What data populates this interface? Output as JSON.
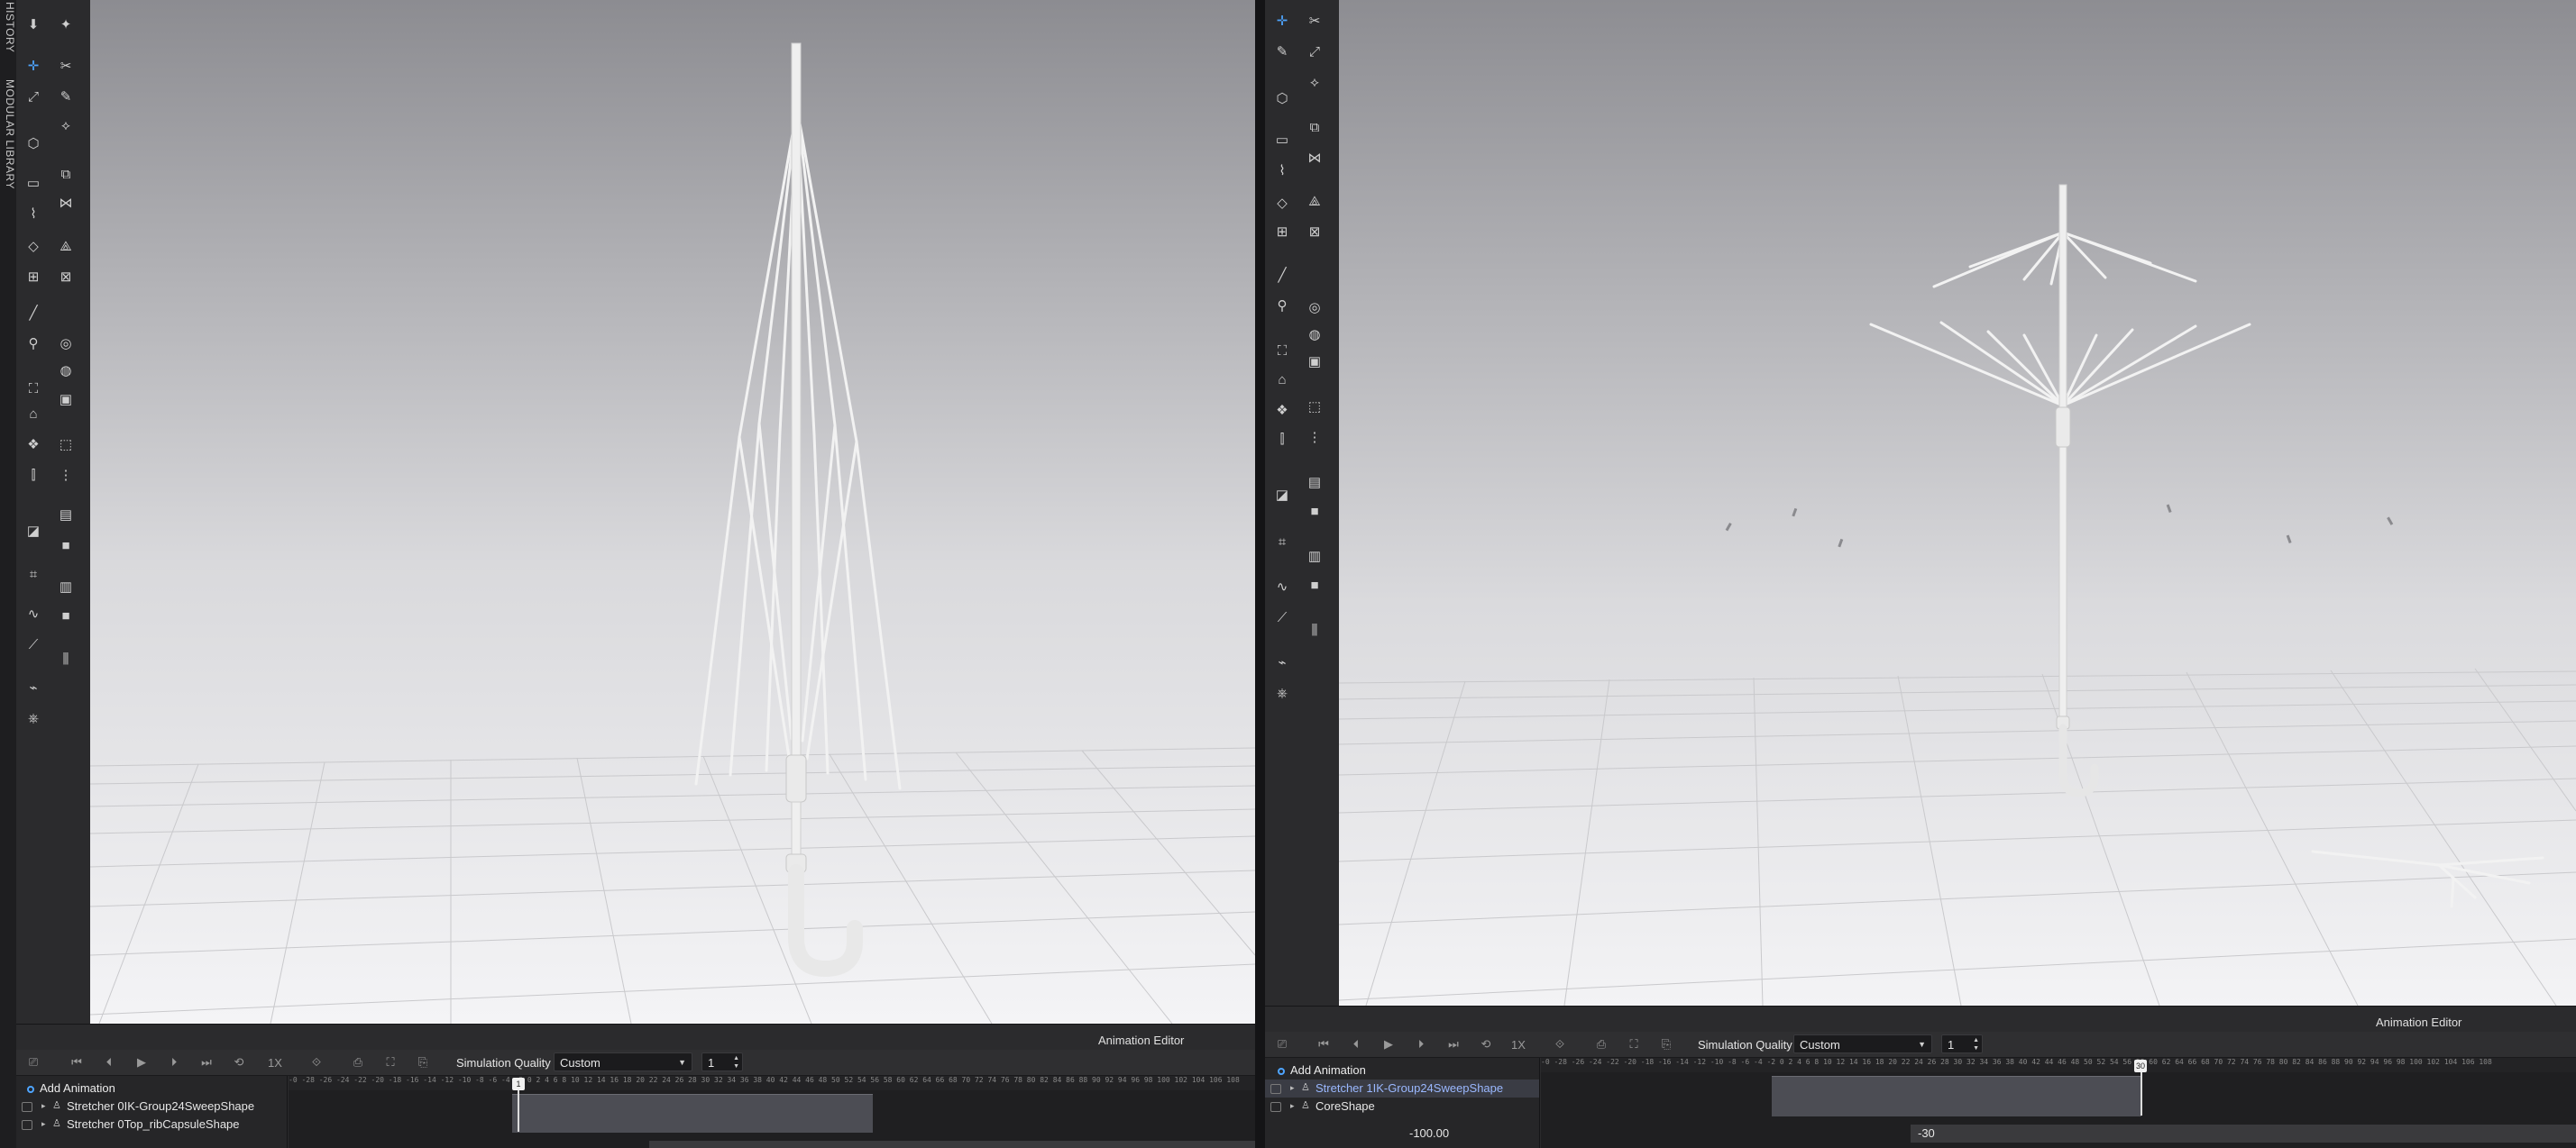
{
  "side_tabs": [
    "HISTORY",
    "MODULAR LIBRARY"
  ],
  "left": {
    "animation_editor": {
      "title": "Animation Editor",
      "speed_label": "1X",
      "simulation_quality_label": "Simulation Quality",
      "simulation_quality_value": "Custom",
      "step_value": "1",
      "add_animation_label": "Add Animation",
      "tracks": [
        {
          "name": "Stretcher 0IK-Group24SweepShape",
          "selected": false
        },
        {
          "name": "Stretcher 0Top_ribCapsuleShape",
          "selected": false
        }
      ],
      "playhead_label": "1",
      "ruler_text": "-0 -28 -26 -24 -22 -20 -18 -16 -14 -12 -10 -8 -6 -4 -2 0 2 4 6 8 10 12 14 16 18 20 22 24 26 28 30 32 34 36 38 40 42 44 46 48 50 52 54 56 58 60 62 64 66 68 70 72 74 76 78 80 82 84 86 88 90 92 94 96 98 100 102 104 106 108"
    }
  },
  "right": {
    "animation_editor": {
      "title": "Animation Editor",
      "speed_label": "1X",
      "simulation_quality_label": "Simulation Quality",
      "simulation_quality_value": "Custom",
      "step_value": "1",
      "add_animation_label": "Add Animation",
      "tracks": [
        {
          "name": "Stretcher 1IK-Group24SweepShape",
          "selected": true
        },
        {
          "name": "CoreShape",
          "selected": false
        }
      ],
      "playhead_label": "30",
      "ruler_text": "-0 -28 -26 -24 -22 -20 -18 -16 -14 -12 -10 -8 -6 -4 -2 0 2 4 6 8 10 12 14 16 18 20 22 24 26 28 30 32 34 36 38 40 42 44 46 48 50 52 54 56 58 60 62 64 66 68 70 72 74 76 78 80 82 84 86 88 90 92 94 96 98 100 102 104 106 108",
      "value_left": "-100.00",
      "value_right": "-30"
    }
  },
  "colors": {
    "accent": "#4ea5ff",
    "viewport_top": "#8d8d92",
    "viewport_bottom": "#f2f2f4"
  }
}
